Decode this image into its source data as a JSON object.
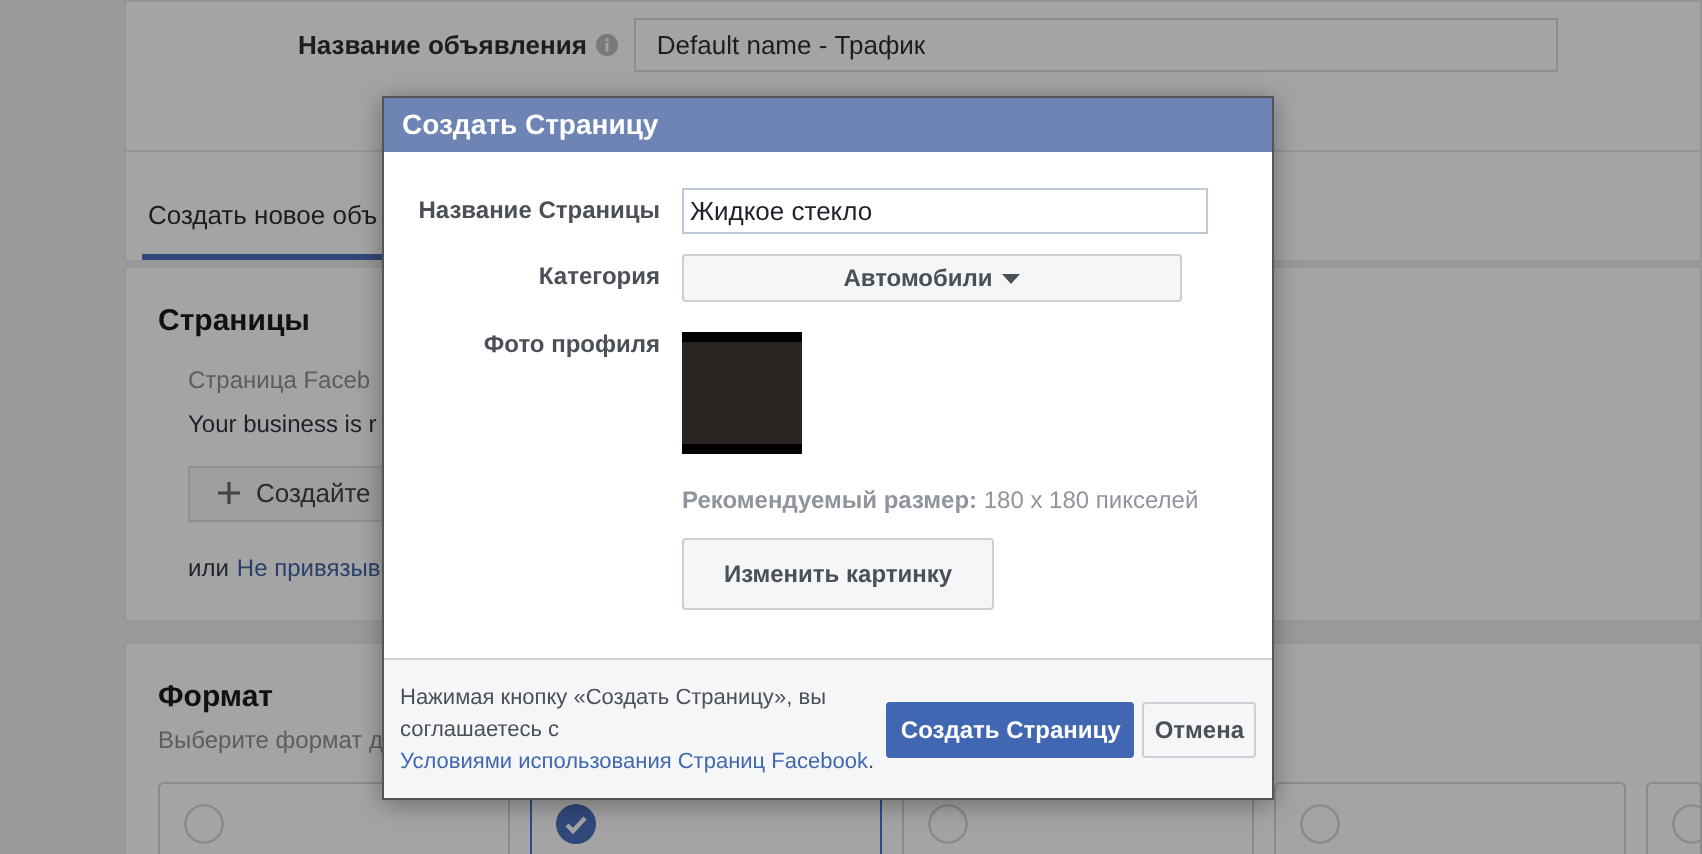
{
  "ad_name": {
    "label": "Название объявления",
    "value": "Default name - Трафик"
  },
  "tab": {
    "label": "Создать новое объ",
    "selected": true
  },
  "pages": {
    "title": "Страницы",
    "page_label": "Страница Faceb",
    "business_text": "Your business is r",
    "create_button": "Создайте",
    "or_text": "или",
    "unlink_link": "Не привязыв"
  },
  "format": {
    "title": "Формат",
    "subtitle": "Выберите формат д",
    "options": [
      {
        "selected": false
      },
      {
        "selected": true
      },
      {
        "selected": false
      },
      {
        "selected": false
      },
      {
        "selected": false
      }
    ]
  },
  "dialog": {
    "title": "Создать Страницу",
    "fields": [
      {
        "kind": "text",
        "label": "Название Страницы",
        "value": "Жидкое стекло"
      },
      {
        "kind": "select",
        "label": "Категория",
        "value": "Автомобили"
      },
      {
        "kind": "photo",
        "label": "Фото профиля",
        "hint": "**Рекомендуемый размер:** 180 x 180 пикселей",
        "button": "Изменить картинку"
      }
    ],
    "terms_text": "Нажимая кнопку «Создать Страницу», вы соглашаетесь с",
    "terms_link": "Условиями использования Страниц Facebook",
    "terms_end": ".",
    "buttons": [
      {
        "kind": "primary",
        "label": "Создать Страницу"
      },
      {
        "kind": "secondary",
        "label": "Отмена"
      }
    ]
  }
}
